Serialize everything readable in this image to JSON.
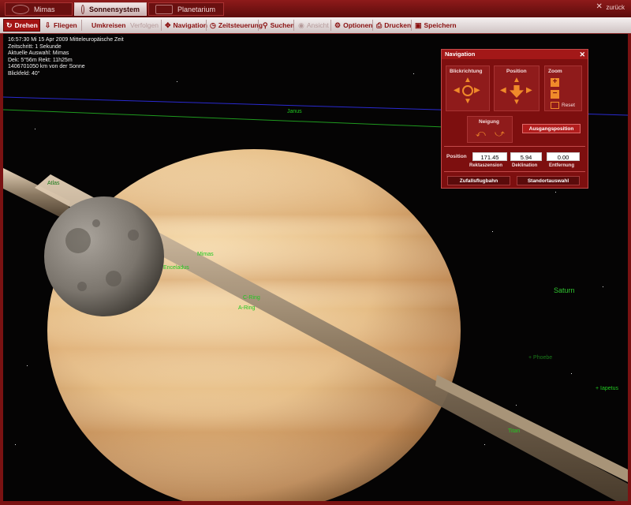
{
  "tabs": [
    {
      "label": "Mimas"
    },
    {
      "label": "Sonnensystem"
    },
    {
      "label": "Planetarium"
    }
  ],
  "back_label": "zurück",
  "toolbar": {
    "drehen": "Drehen",
    "fliegen": "Fliegen",
    "umkreisen": "Umkreisen",
    "verfolgen": "Verfolgen",
    "navigation": "Navigation",
    "zeitsteuerung": "Zeitsteuerung",
    "suchen": "Suchen",
    "ansicht": "Ansicht",
    "optionen": "Optionen",
    "drucken": "Drucken",
    "speichern": "Speichern"
  },
  "info": {
    "line1": "16:57:30 Mi   15 Apr  2009 Mitteleuropäische Zeit",
    "line2": "Zeitschritt: 1 Sekunde",
    "line3": "Aktuelle Auswahl: Mimas",
    "line4": "Dek: 5°56m Rekt: 11h25m",
    "line5": "1406701050 km von der Sonne",
    "line6": "Blickfeld: 40°"
  },
  "labels": {
    "saturn": "Saturn",
    "phoebe": "+ Phoebe",
    "iapetus": "+ Iapetus",
    "mimas": "Mimas",
    "enceladus": "Enceladus",
    "cring": "C-Ring",
    "aring": "A-Ring",
    "titan": "Titan",
    "atlas": "Atlas",
    "janus": "Janus"
  },
  "nav_panel": {
    "title": "Navigation",
    "blickrichtung": "Blickrichtung",
    "position": "Position",
    "zoom": "Zoom",
    "reset": "Reset",
    "neigung": "Neigung",
    "ausgangsposition": "Ausgangsposition",
    "position_label": "Position",
    "rektaszension_value": "171.45",
    "deklination_value": "5.94",
    "entfernung_value": "0.00",
    "rektaszension_label": "Rektaszension",
    "deklination_label": "Deklination",
    "entfernung_label": "Entfernung",
    "zufallsflugbahn": "Zufallsflugbahn",
    "standortauswahl": "Standortauswahl"
  },
  "colors": {
    "accent": "#a31414",
    "label_green": "#21c821",
    "arrow_orange": "#f08a2a"
  }
}
